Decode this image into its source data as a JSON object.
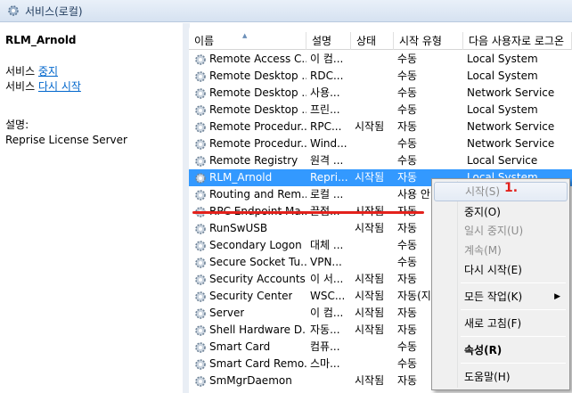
{
  "window": {
    "title": "서비스(로컬)"
  },
  "details": {
    "service_name": "RLM_Arnold",
    "action1_prefix": "서비스 ",
    "action1_link": "중지",
    "action2_prefix": "서비스 ",
    "action2_link": "다시 시작",
    "desc_label": "설명:",
    "desc_text": "Reprise License Server"
  },
  "columns": {
    "name": "이름",
    "desc": "설명",
    "status": "상태",
    "startup": "시작 유형",
    "logon": "다음 사용자로 로그온"
  },
  "services": [
    {
      "name": "Remote Access C...",
      "desc": "이 컴...",
      "status": "",
      "startup": "수동",
      "logon": "Local System"
    },
    {
      "name": "Remote Desktop ...",
      "desc": "RDC...",
      "status": "",
      "startup": "수동",
      "logon": "Local System"
    },
    {
      "name": "Remote Desktop ...",
      "desc": "사용...",
      "status": "",
      "startup": "수동",
      "logon": "Network Service"
    },
    {
      "name": "Remote Desktop ...",
      "desc": "프린...",
      "status": "",
      "startup": "수동",
      "logon": "Local System"
    },
    {
      "name": "Remote Procedur...",
      "desc": "RPC...",
      "status": "시작됨",
      "startup": "자동",
      "logon": "Network Service"
    },
    {
      "name": "Remote Procedur...",
      "desc": "Wind...",
      "status": "",
      "startup": "수동",
      "logon": "Network Service"
    },
    {
      "name": "Remote Registry",
      "desc": "원격 ...",
      "status": "",
      "startup": "수동",
      "logon": "Local Service"
    },
    {
      "name": "RLM_Arnold",
      "desc": "Repri...",
      "status": "시작됨",
      "startup": "자동",
      "logon": "Local System"
    },
    {
      "name": "Routing and Rem...",
      "desc": "로컬 ...",
      "status": "",
      "startup": "사용 안",
      "logon": ""
    },
    {
      "name": "RPC Endpoint Ma...",
      "desc": "끝점...",
      "status": "시작됨",
      "startup": "자동",
      "logon": ""
    },
    {
      "name": "RunSwUSB",
      "desc": "",
      "status": "시작됨",
      "startup": "자동",
      "logon": ""
    },
    {
      "name": "Secondary Logon",
      "desc": "대체 ...",
      "status": "",
      "startup": "수동",
      "logon": ""
    },
    {
      "name": "Secure Socket Tu...",
      "desc": "VPN...",
      "status": "",
      "startup": "수동",
      "logon": ""
    },
    {
      "name": "Security Accounts...",
      "desc": "이 서...",
      "status": "시작됨",
      "startup": "자동",
      "logon": ""
    },
    {
      "name": "Security Center",
      "desc": "WSC...",
      "status": "시작됨",
      "startup": "자동(지",
      "logon": ""
    },
    {
      "name": "Server",
      "desc": "이 컴...",
      "status": "시작됨",
      "startup": "자동",
      "logon": ""
    },
    {
      "name": "Shell Hardware D...",
      "desc": "자동...",
      "status": "시작됨",
      "startup": "자동",
      "logon": ""
    },
    {
      "name": "Smart Card",
      "desc": "컴퓨...",
      "status": "",
      "startup": "수동",
      "logon": ""
    },
    {
      "name": "Smart Card Remo...",
      "desc": "스마...",
      "status": "",
      "startup": "수동",
      "logon": ""
    },
    {
      "name": "SmMgrDaemon",
      "desc": "",
      "status": "시작됨",
      "startup": "자동",
      "logon": ""
    }
  ],
  "selected_index": 7,
  "context_menu": {
    "start": "시작(S)",
    "stop": "중지(O)",
    "pause": "일시 중지(U)",
    "resume": "계속(M)",
    "restart": "다시 시작(E)",
    "all_tasks": "모든 작업(K)",
    "refresh": "새로 고침(F)",
    "properties": "속성(R)",
    "help": "도움말(H)"
  },
  "annotation": "1.",
  "colors": {
    "selection": "#3399ff",
    "annotation": "#e3211c",
    "link": "#0066cc"
  }
}
